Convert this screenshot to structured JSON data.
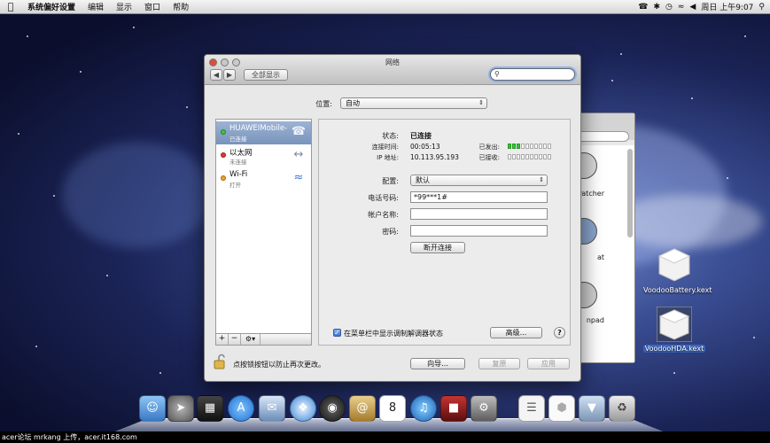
{
  "menubar": {
    "app_name": "系统偏好设置",
    "items": [
      "编辑",
      "显示",
      "窗口",
      "帮助"
    ],
    "clock": "周日 上午9:07"
  },
  "window": {
    "title": "网络",
    "show_all_label": "全部显示",
    "search_placeholder": "",
    "location_label": "位置:",
    "location_value": "自动",
    "services": [
      {
        "name": "HUAWEIMobile-",
        "status": "已连接",
        "dot_color": "#3cc83c",
        "icon": "phone-icon"
      },
      {
        "name": "以太网",
        "status": "未连接",
        "dot_color": "#e23a2a",
        "icon": "ethernet-arrows-icon"
      },
      {
        "name": "Wi-Fi",
        "status": "打开",
        "dot_color": "#f3a21e",
        "icon": "wifi-icon"
      }
    ],
    "detail": {
      "status_label": "状态:",
      "status_value": "已连接",
      "conn_time_label": "连接时间:",
      "conn_time_value": "00:05:13",
      "ip_label": "IP 地址:",
      "ip_value": "10.113.95.193",
      "sent_label": "已发出:",
      "received_label": "已接收:",
      "sent_level": 0.25,
      "received_level": 0.0,
      "config_label": "配置:",
      "config_value": "默认",
      "phone_label": "电话号码:",
      "phone_value": "*99***1#",
      "account_label": "帐户名称:",
      "account_value": "",
      "password_label": "密码:",
      "password_value": "",
      "disconnect_label": "断开连接",
      "menubar_checkbox_label": "在菜单栏中显示调制解调器状态",
      "menubar_checkbox_checked": true,
      "advanced_label": "高级...",
      "help_label": "?"
    },
    "lock_text": "点按锁按钮以防止再次更改。",
    "assist_label": "向导...",
    "revert_label": "复原",
    "apply_label": "应用"
  },
  "background_window": {
    "items": [
      "–Patcher",
      "at",
      "npad"
    ]
  },
  "desktop": {
    "icons": [
      {
        "label": "VoodooBattery.kext",
        "selected": false
      },
      {
        "label": "VoodooHDA.kext",
        "selected": true
      }
    ]
  },
  "footer_credit": "acer论坛 mrkang 上传，acer.it168.com",
  "accent_color": "#3d74d6"
}
